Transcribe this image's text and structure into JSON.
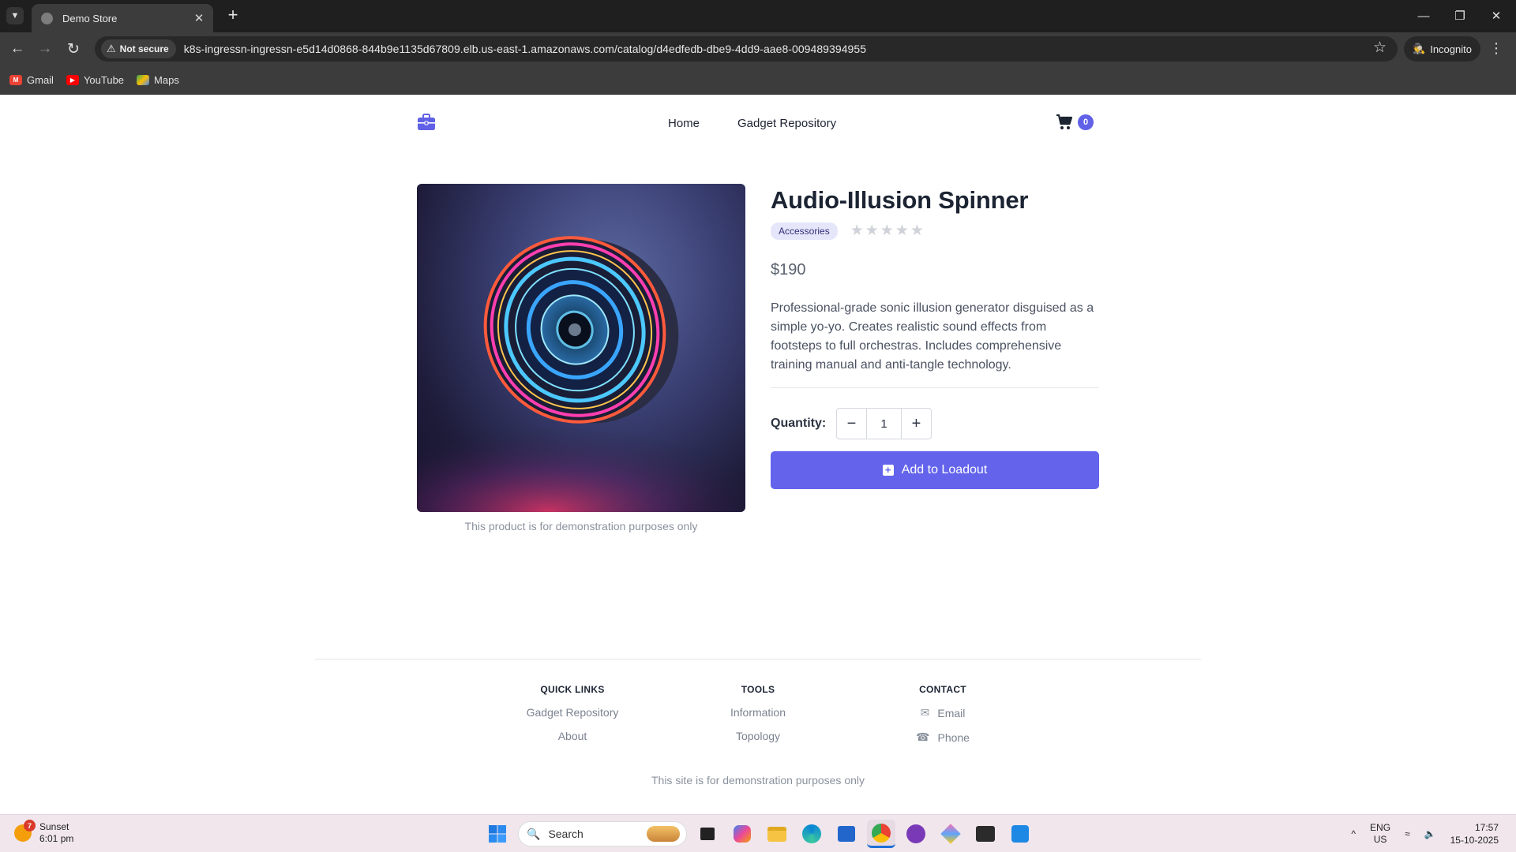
{
  "browser": {
    "tab_title": "Demo Store",
    "security_label": "Not secure",
    "url": "k8s-ingressn-ingressn-e5d14d0868-844b9e1135d67809.elb.us-east-1.amazonaws.com/catalog/d4edfedb-dbe9-4dd9-aae8-009489394955",
    "profile_label": "Incognito",
    "bookmarks": [
      {
        "label": "Gmail"
      },
      {
        "label": "YouTube"
      },
      {
        "label": "Maps"
      }
    ]
  },
  "header": {
    "nav": [
      "Home",
      "Gadget Repository"
    ],
    "cart_count": "0"
  },
  "product": {
    "title": "Audio-Illusion Spinner",
    "category": "Accessories",
    "rating": 0,
    "rating_max": 5,
    "price": "$190",
    "description": "Professional-grade sonic illusion generator disguised as a simple yo-yo. Creates realistic sound effects from footsteps to full orchestras. Includes comprehensive training manual and anti-tangle technology.",
    "image_caption": "This product is for demonstration purposes only",
    "quantity_label": "Quantity:",
    "quantity": "1",
    "add_button": "Add to Loadout"
  },
  "footer": {
    "columns": [
      {
        "heading": "QUICK LINKS",
        "links": [
          "Gadget Repository",
          "About"
        ]
      },
      {
        "heading": "TOOLS",
        "links": [
          "Information",
          "Topology"
        ]
      },
      {
        "heading": "CONTACT",
        "links": [
          "Email",
          "Phone"
        ]
      }
    ],
    "note": "This site is for demonstration purposes only"
  },
  "taskbar": {
    "weather_badge": "7",
    "weather_title": "Sunset",
    "weather_time": "6:01 pm",
    "search_placeholder": "Search",
    "lang_top": "ENG",
    "lang_bottom": "US",
    "time": "17:57",
    "date": "15-10-2025"
  },
  "colors": {
    "accent": "#6363ec",
    "badge_bg": "#e6e6fa"
  }
}
